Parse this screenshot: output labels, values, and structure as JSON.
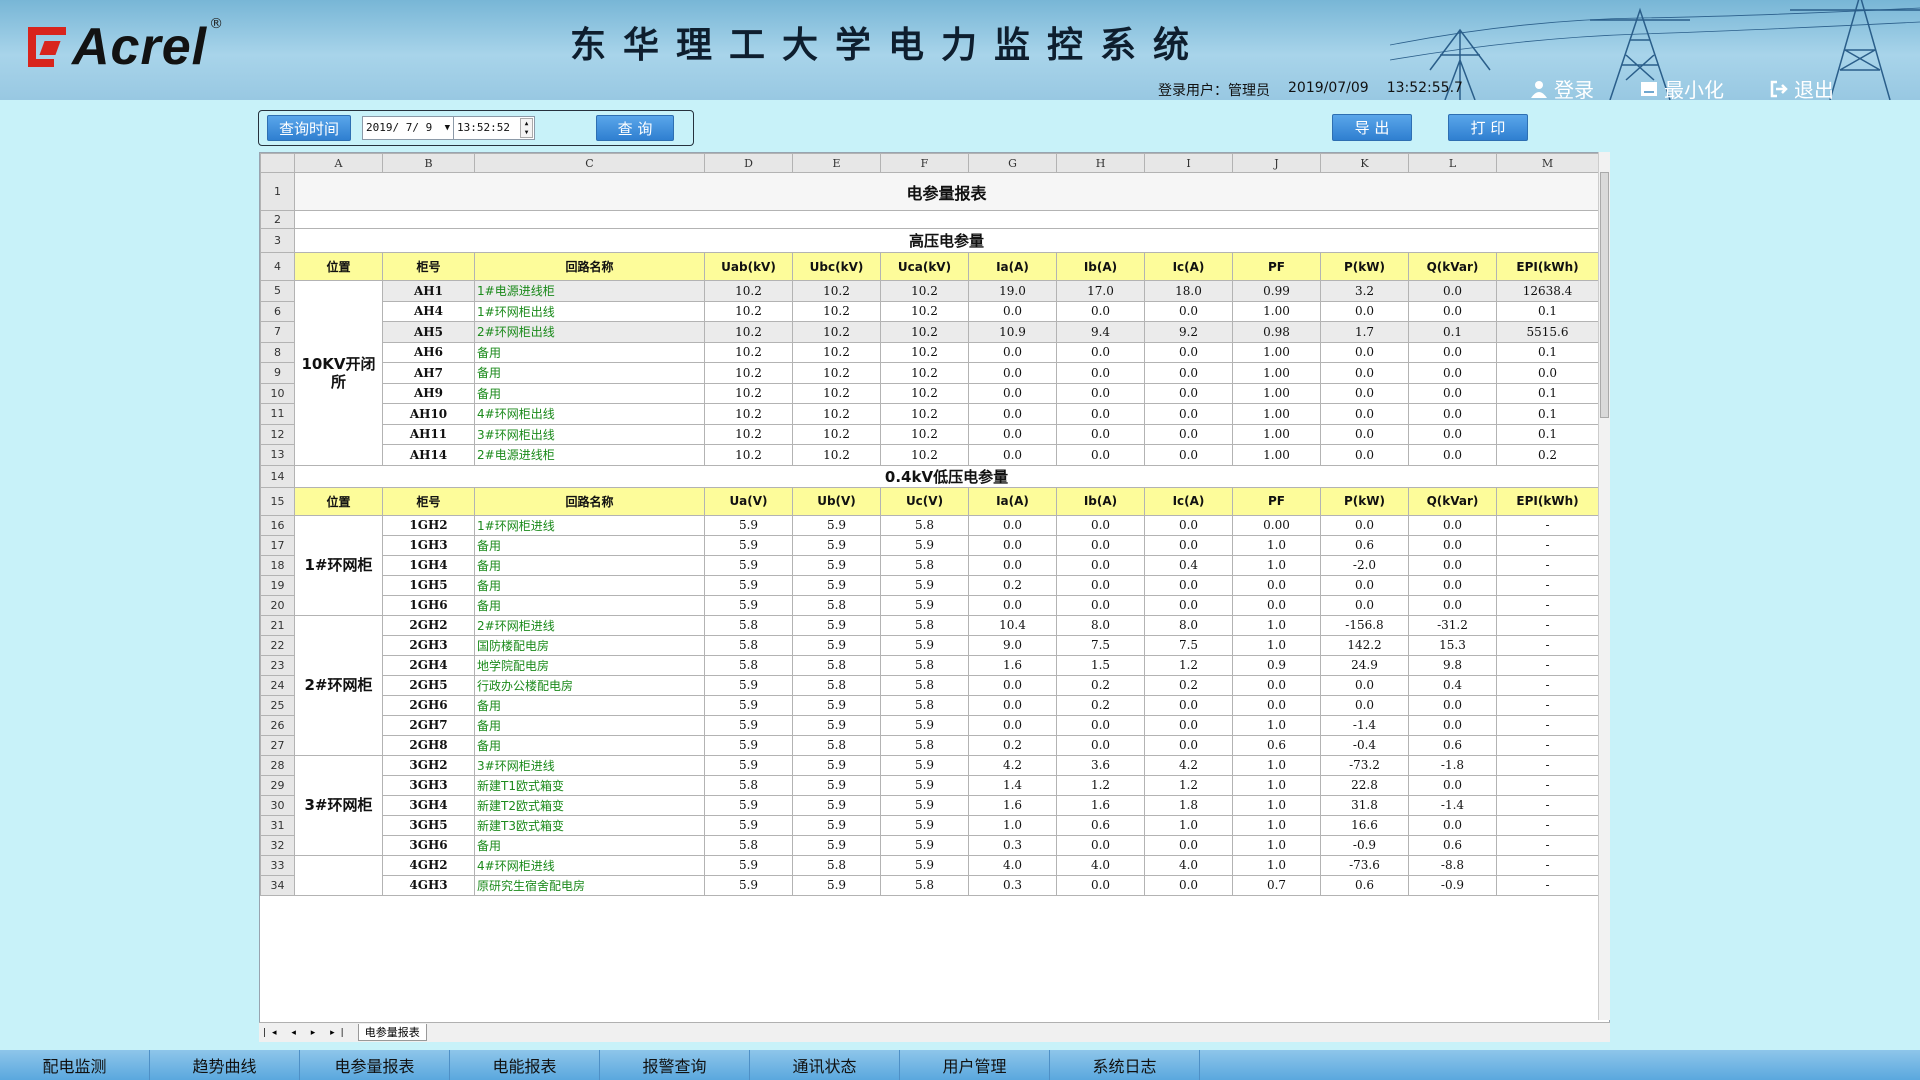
{
  "header": {
    "brand": "Acrel",
    "brand_mark": "®",
    "title": "东华理工大学电力监控系统",
    "login_label": "登录用户：",
    "login_user": "管理员",
    "login_date": "2019/07/09",
    "login_time": "13:52:55.7",
    "buttons": {
      "login": "登录",
      "minimize": "最小化",
      "exit": "退出"
    }
  },
  "query": {
    "time_label": "查询时间",
    "date": "2019/ 7/ 9",
    "time": "13:52:52",
    "query_btn": "查 询",
    "export_btn": "导 出",
    "print_btn": "打 印"
  },
  "sheet": {
    "columns": [
      "A",
      "B",
      "C",
      "D",
      "E",
      "F",
      "G",
      "H",
      "I",
      "J",
      "K",
      "L",
      "M"
    ],
    "title": "电参量报表",
    "hv_title": "高压电参量",
    "lv_title": "0.4kV低压电参量",
    "hv_headers": [
      "位置",
      "柜号",
      "回路名称",
      "Uab(kV)",
      "Ubc(kV)",
      "Uca(kV)",
      "Ia(A)",
      "Ib(A)",
      "Ic(A)",
      "PF",
      "P(kW)",
      "Q(kVar)",
      "EPI(kWh)"
    ],
    "lv_headers": [
      "位置",
      "柜号",
      "回路名称",
      "Ua(V)",
      "Ub(V)",
      "Uc(V)",
      "Ia(A)",
      "Ib(A)",
      "Ic(A)",
      "PF",
      "P(kW)",
      "Q(kVar)",
      "EPI(kWh)"
    ],
    "hv_groups": [
      {
        "position": "10KV开闭所",
        "rows": [
          [
            "AH1",
            "1#电源进线柜",
            "10.2",
            "10.2",
            "10.2",
            "19.0",
            "17.0",
            "18.0",
            "0.99",
            "3.2",
            "0.0",
            "12638.4"
          ],
          [
            "AH4",
            "1#环网柜出线",
            "10.2",
            "10.2",
            "10.2",
            "0.0",
            "0.0",
            "0.0",
            "1.00",
            "0.0",
            "0.0",
            "0.1"
          ],
          [
            "AH5",
            "2#环网柜出线",
            "10.2",
            "10.2",
            "10.2",
            "10.9",
            "9.4",
            "9.2",
            "0.98",
            "1.7",
            "0.1",
            "5515.6"
          ],
          [
            "AH6",
            "备用",
            "10.2",
            "10.2",
            "10.2",
            "0.0",
            "0.0",
            "0.0",
            "1.00",
            "0.0",
            "0.0",
            "0.1"
          ],
          [
            "AH7",
            "备用",
            "10.2",
            "10.2",
            "10.2",
            "0.0",
            "0.0",
            "0.0",
            "1.00",
            "0.0",
            "0.0",
            "0.0"
          ],
          [
            "AH9",
            "备用",
            "10.2",
            "10.2",
            "10.2",
            "0.0",
            "0.0",
            "0.0",
            "1.00",
            "0.0",
            "0.0",
            "0.1"
          ],
          [
            "AH10",
            "4#环网柜出线",
            "10.2",
            "10.2",
            "10.2",
            "0.0",
            "0.0",
            "0.0",
            "1.00",
            "0.0",
            "0.0",
            "0.1"
          ],
          [
            "AH11",
            "3#环网柜出线",
            "10.2",
            "10.2",
            "10.2",
            "0.0",
            "0.0",
            "0.0",
            "1.00",
            "0.0",
            "0.0",
            "0.1"
          ],
          [
            "AH14",
            "2#电源进线柜",
            "10.2",
            "10.2",
            "10.2",
            "0.0",
            "0.0",
            "0.0",
            "1.00",
            "0.0",
            "0.0",
            "0.2"
          ]
        ]
      }
    ],
    "lv_groups": [
      {
        "position": "1#环网柜",
        "rows": [
          [
            "1GH2",
            "1#环网柜进线",
            "5.9",
            "5.9",
            "5.8",
            "0.0",
            "0.0",
            "0.0",
            "0.00",
            "0.0",
            "0.0",
            "-"
          ],
          [
            "1GH3",
            "备用",
            "5.9",
            "5.9",
            "5.9",
            "0.0",
            "0.0",
            "0.0",
            "1.0",
            "0.6",
            "0.0",
            "-"
          ],
          [
            "1GH4",
            "备用",
            "5.9",
            "5.9",
            "5.8",
            "0.0",
            "0.0",
            "0.4",
            "1.0",
            "-2.0",
            "0.0",
            "-"
          ],
          [
            "1GH5",
            "备用",
            "5.9",
            "5.9",
            "5.9",
            "0.2",
            "0.0",
            "0.0",
            "0.0",
            "0.0",
            "0.0",
            "-"
          ],
          [
            "1GH6",
            "备用",
            "5.9",
            "5.8",
            "5.9",
            "0.0",
            "0.0",
            "0.0",
            "0.0",
            "0.0",
            "0.0",
            "-"
          ]
        ]
      },
      {
        "position": "2#环网柜",
        "rows": [
          [
            "2GH2",
            "2#环网柜进线",
            "5.8",
            "5.9",
            "5.8",
            "10.4",
            "8.0",
            "8.0",
            "1.0",
            "-156.8",
            "-31.2",
            "-"
          ],
          [
            "2GH3",
            "国防楼配电房",
            "5.8",
            "5.9",
            "5.9",
            "9.0",
            "7.5",
            "7.5",
            "1.0",
            "142.2",
            "15.3",
            "-"
          ],
          [
            "2GH4",
            "地学院配电房",
            "5.8",
            "5.8",
            "5.8",
            "1.6",
            "1.5",
            "1.2",
            "0.9",
            "24.9",
            "9.8",
            "-"
          ],
          [
            "2GH5",
            "行政办公楼配电房",
            "5.9",
            "5.8",
            "5.8",
            "0.0",
            "0.2",
            "0.2",
            "0.0",
            "0.0",
            "0.4",
            "-"
          ],
          [
            "2GH6",
            "备用",
            "5.9",
            "5.9",
            "5.8",
            "0.0",
            "0.2",
            "0.0",
            "0.0",
            "0.0",
            "0.0",
            "-"
          ],
          [
            "2GH7",
            "备用",
            "5.9",
            "5.9",
            "5.9",
            "0.0",
            "0.0",
            "0.0",
            "1.0",
            "-1.4",
            "0.0",
            "-"
          ],
          [
            "2GH8",
            "备用",
            "5.9",
            "5.8",
            "5.8",
            "0.2",
            "0.0",
            "0.0",
            "0.6",
            "-0.4",
            "0.6",
            "-"
          ]
        ]
      },
      {
        "position": "3#环网柜",
        "rows": [
          [
            "3GH2",
            "3#环网柜进线",
            "5.9",
            "5.9",
            "5.9",
            "4.2",
            "3.6",
            "4.2",
            "1.0",
            "-73.2",
            "-1.8",
            "-"
          ],
          [
            "3GH3",
            "新建T1欧式箱变",
            "5.8",
            "5.9",
            "5.9",
            "1.4",
            "1.2",
            "1.2",
            "1.0",
            "22.8",
            "0.0",
            "-"
          ],
          [
            "3GH4",
            "新建T2欧式箱变",
            "5.9",
            "5.9",
            "5.9",
            "1.6",
            "1.6",
            "1.8",
            "1.0",
            "31.8",
            "-1.4",
            "-"
          ],
          [
            "3GH5",
            "新建T3欧式箱变",
            "5.9",
            "5.9",
            "5.9",
            "1.0",
            "0.6",
            "1.0",
            "1.0",
            "16.6",
            "0.0",
            "-"
          ],
          [
            "3GH6",
            "备用",
            "5.8",
            "5.9",
            "5.9",
            "0.3",
            "0.0",
            "0.0",
            "1.0",
            "-0.9",
            "0.6",
            "-"
          ]
        ]
      },
      {
        "position": "",
        "rows": [
          [
            "4GH2",
            "4#环网柜进线",
            "5.9",
            "5.8",
            "5.9",
            "4.0",
            "4.0",
            "4.0",
            "1.0",
            "-73.6",
            "-8.8",
            "-"
          ],
          [
            "4GH3",
            "原研究生宿舍配电房",
            "5.9",
            "5.9",
            "5.8",
            "0.3",
            "0.0",
            "0.0",
            "0.7",
            "0.6",
            "-0.9",
            "-"
          ]
        ]
      }
    ],
    "sheet_tab": "电参量报表"
  },
  "nav": [
    "配电监测",
    "趋势曲线",
    "电参量报表",
    "电能报表",
    "报警查询",
    "通讯状态",
    "用户管理",
    "系统日志"
  ]
}
